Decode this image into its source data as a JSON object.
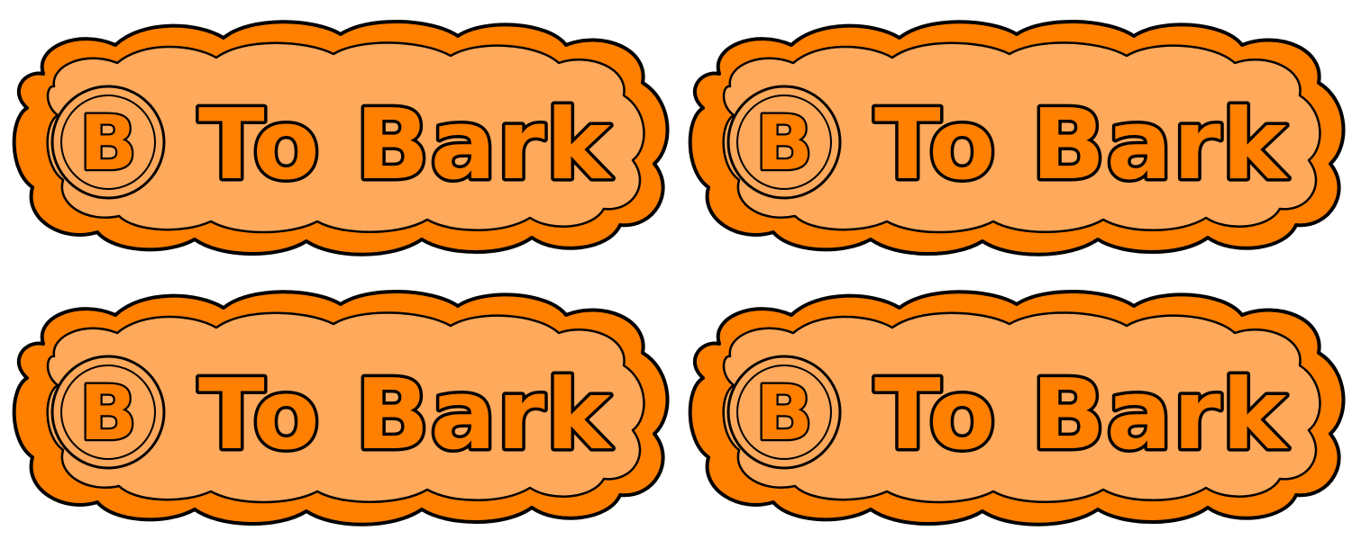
{
  "colors": {
    "accent": "#FF7F00",
    "fill_light": "#FFA95C",
    "outline": "#000000"
  },
  "prompts": [
    {
      "button_icon": "B-button-icon",
      "button_letter": "B",
      "action_label": "To Bark"
    },
    {
      "button_icon": "B-button-icon",
      "button_letter": "B",
      "action_label": "To Bark"
    },
    {
      "button_icon": "B-button-icon",
      "button_letter": "B",
      "action_label": "To Bark"
    },
    {
      "button_icon": "B-button-icon",
      "button_letter": "B",
      "action_label": "To Bark"
    }
  ]
}
